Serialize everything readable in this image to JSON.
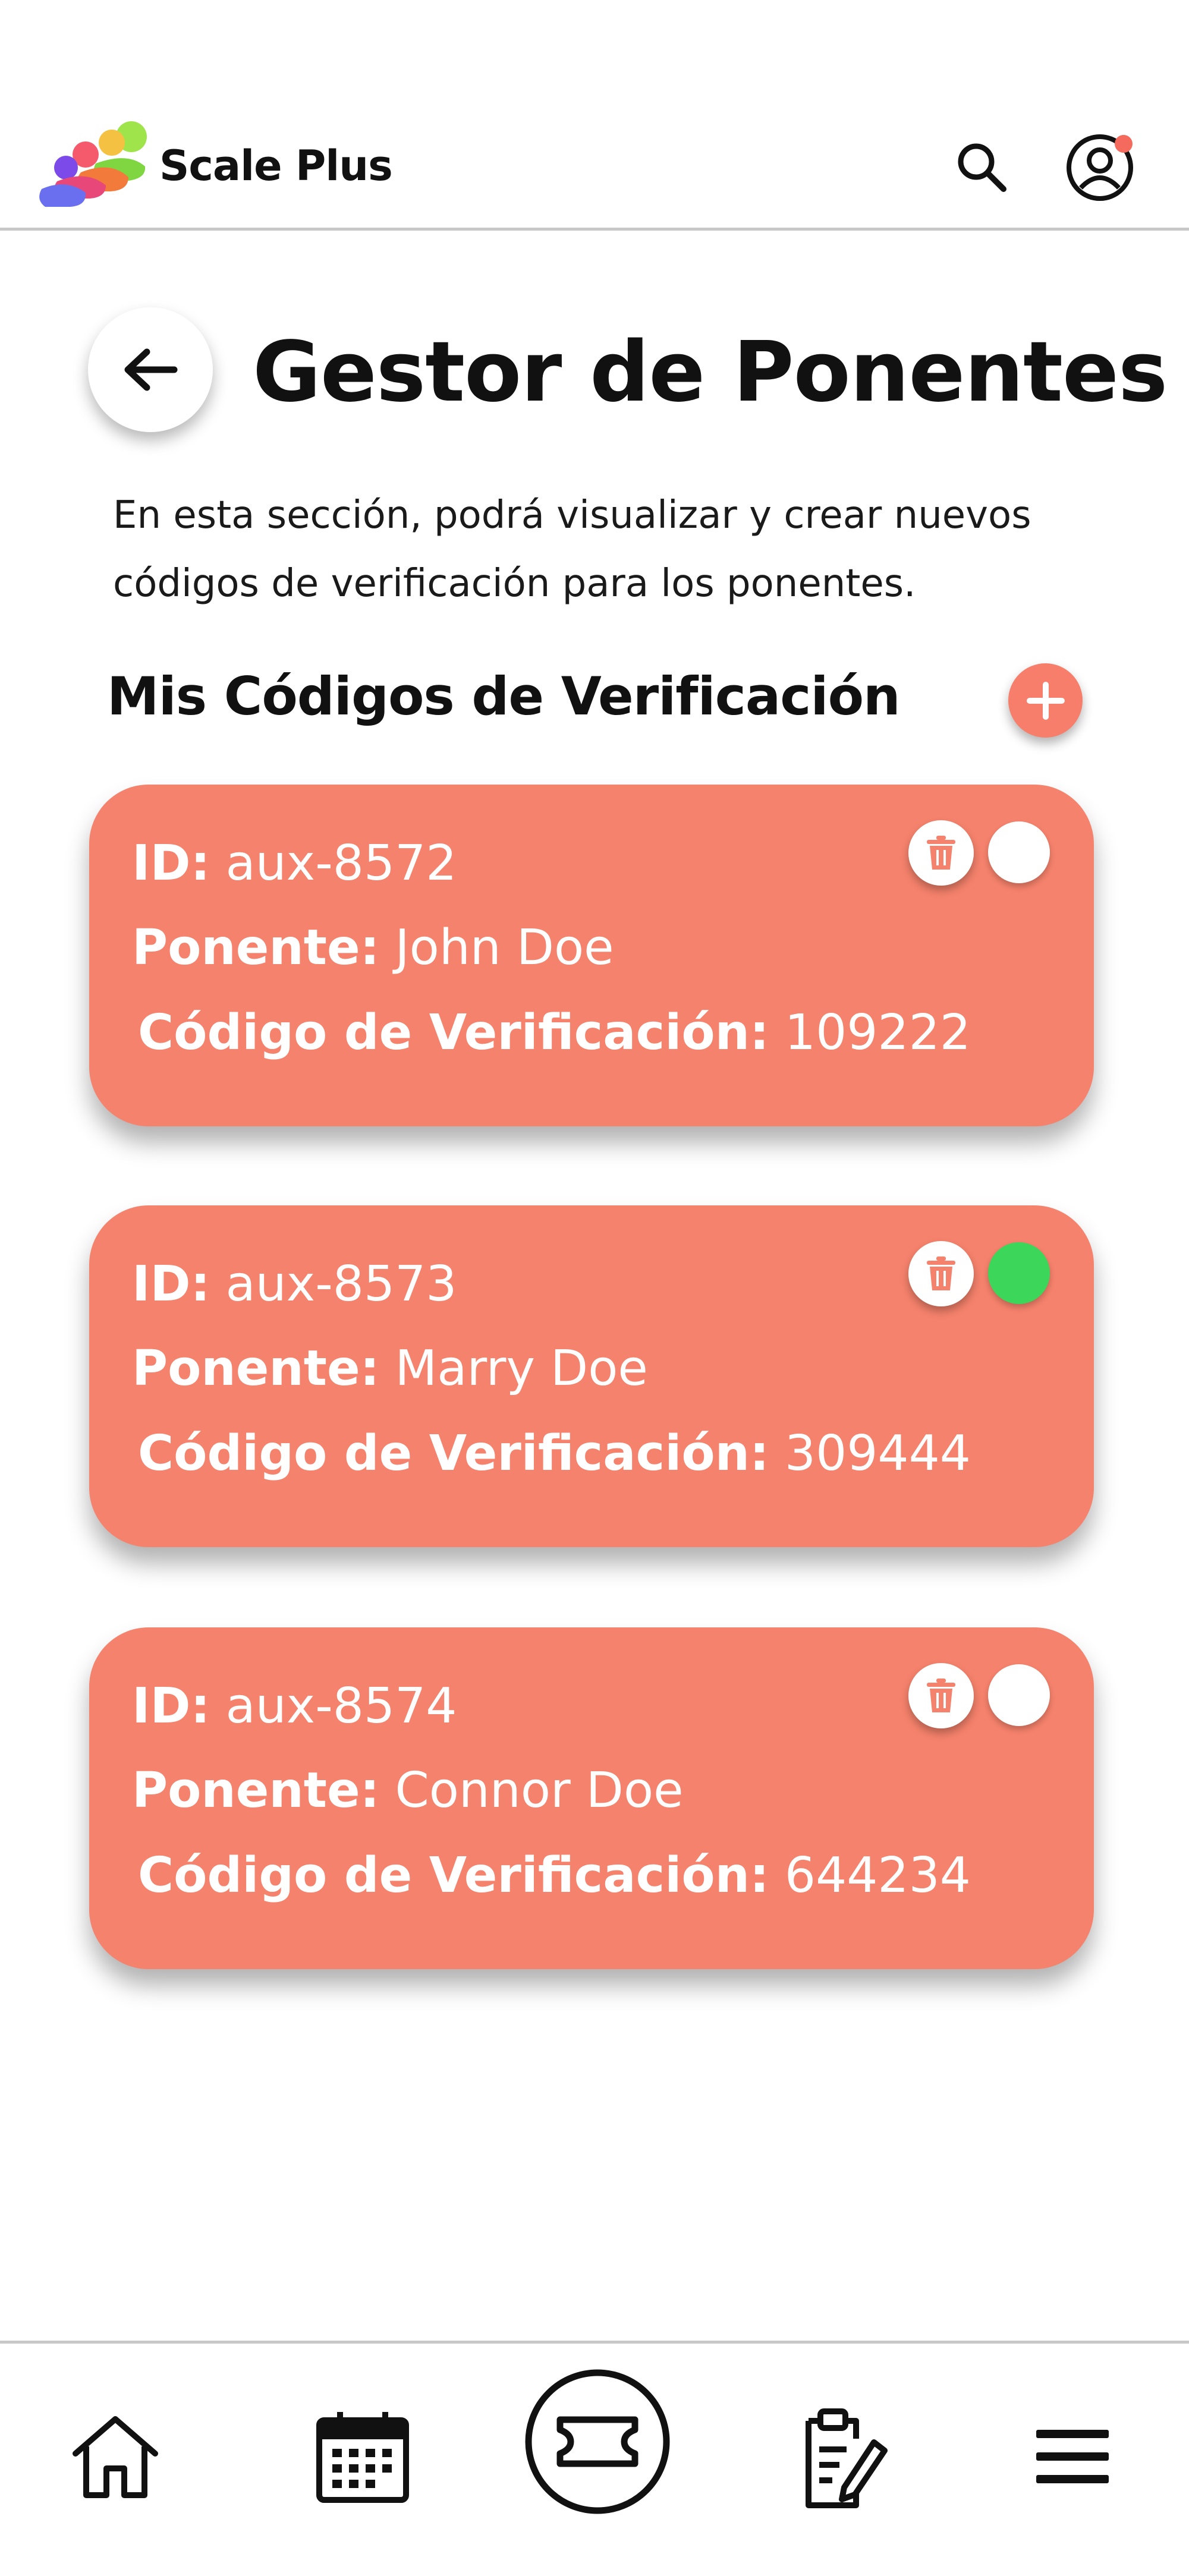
{
  "app": {
    "brand": "Scale Plus"
  },
  "header": {
    "icons": [
      "search-icon",
      "user-account-icon"
    ],
    "notification_color": "#f46b5e"
  },
  "page": {
    "title": "Gestor de Ponentes",
    "description": "En esta sección, podrá visualizar y crear nuevos códigos de verificación para los ponentes."
  },
  "section": {
    "title": "Mis Códigos de Verificación"
  },
  "colors": {
    "card": "#f5826c",
    "status_active": "#3bd65a",
    "status_inactive": "#ffffff"
  },
  "cards": [
    {
      "id_label": "ID:",
      "id_value": "aux-8572",
      "speaker_label": "Ponente:",
      "speaker_value": "John Doe",
      "code_label": "Código de Verificación:",
      "code_value": "109222",
      "active": false
    },
    {
      "id_label": "ID:",
      "id_value": "aux-8573",
      "speaker_label": "Ponente:",
      "speaker_value": "Marry Doe",
      "code_label": "Código de Verificación:",
      "code_value": "309444",
      "active": true
    },
    {
      "id_label": "ID:",
      "id_value": "aux-8574",
      "speaker_label": "Ponente:",
      "speaker_value": "Connor Doe",
      "code_label": "Código de Verificación:",
      "code_value": "644234",
      "active": false
    }
  ],
  "bottom_nav": {
    "items": [
      {
        "icon": "home-icon"
      },
      {
        "icon": "calendar-icon"
      },
      {
        "icon": "ticket-icon"
      },
      {
        "icon": "clipboard-edit-icon"
      },
      {
        "icon": "menu-icon"
      }
    ]
  }
}
